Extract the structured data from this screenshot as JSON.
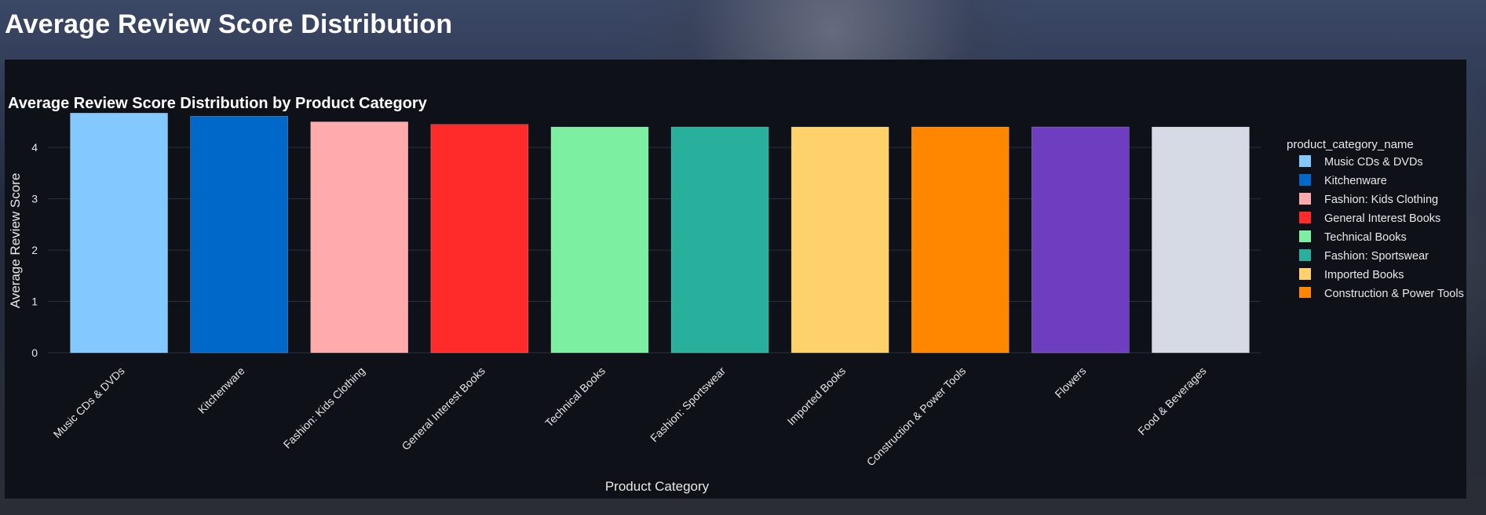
{
  "page": {
    "title": "Average Review Score Distribution"
  },
  "chart_data": {
    "type": "bar",
    "title": "Average Review Score Distribution by Product Category",
    "xlabel": "Product Category",
    "ylabel": "Average Review Score",
    "ylim": [
      0,
      4.95
    ],
    "yticks": [
      0,
      1,
      2,
      3,
      4
    ],
    "grid": true,
    "legend_title": "product_category_name",
    "legend_position": "right",
    "categories": [
      "Music CDs & DVDs",
      "Kitchenware",
      "Fashion: Kids Clothing",
      "General Interest Books",
      "Technical Books",
      "Fashion: Sportswear",
      "Imported Books",
      "Construction & Power Tools",
      "Flowers",
      "Food & Beverages"
    ],
    "values": [
      4.67,
      4.61,
      4.5,
      4.45,
      4.4,
      4.4,
      4.4,
      4.4,
      4.4,
      4.4
    ],
    "colors": [
      "#83c9ff",
      "#0068c9",
      "#ffabab",
      "#ff2b2b",
      "#7defa1",
      "#29b09d",
      "#ffd16a",
      "#ff8700",
      "#6d3fc0",
      "#d5dae5"
    ]
  }
}
